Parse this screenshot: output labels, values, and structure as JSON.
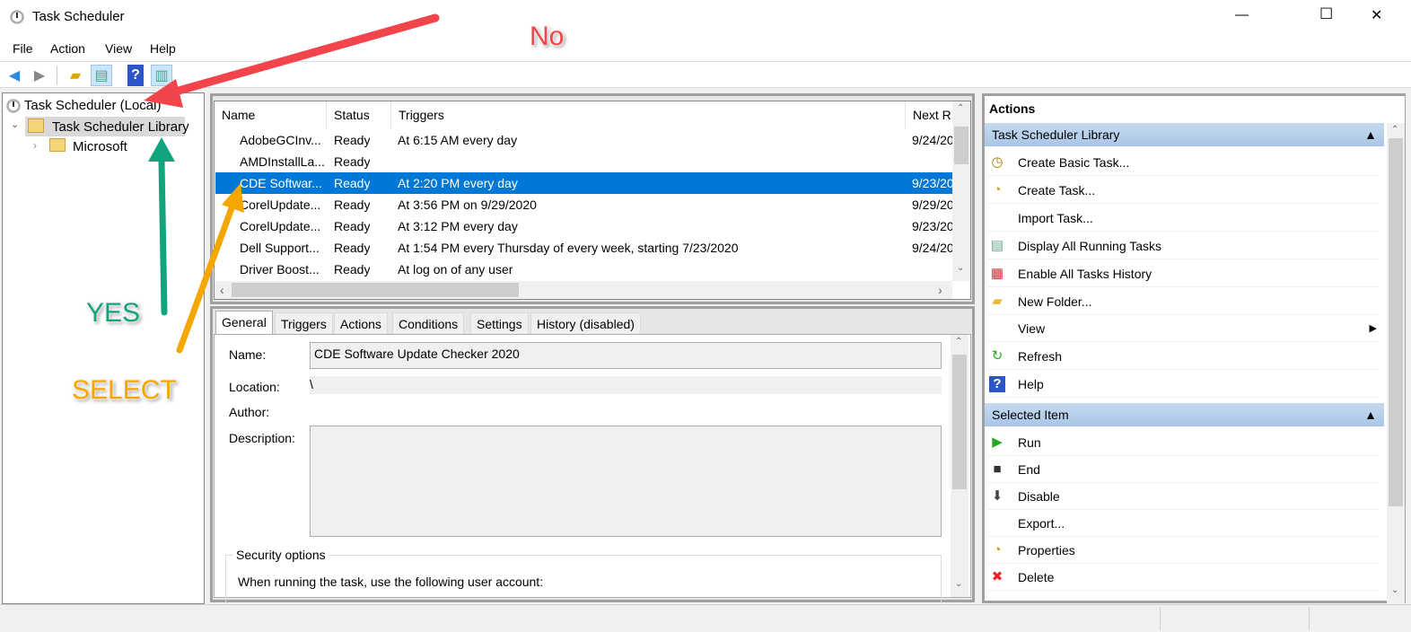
{
  "window": {
    "title": "Task Scheduler",
    "minimize": "—",
    "maximize": "☐",
    "close": "✕"
  },
  "menu": [
    "File",
    "Action",
    "View",
    "Help"
  ],
  "toolbar": {
    "back": "back-icon",
    "forward": "forward-icon",
    "up": "folder-up-icon",
    "show_hide_console_tree": "console-tree-icon",
    "help": "help-icon",
    "show_hide_action_pane": "action-pane-icon"
  },
  "tree": {
    "root": "Task Scheduler (Local)",
    "library": "Task Scheduler Library",
    "child": "Microsoft"
  },
  "task_list": {
    "columns": [
      "Name",
      "Status",
      "Triggers",
      "Next R"
    ],
    "rows": [
      {
        "name": "AdobeGCInv...",
        "status": "Ready",
        "trigger": "At 6:15 AM every day",
        "next": "9/24/20"
      },
      {
        "name": "AMDInstallLa...",
        "status": "Ready",
        "trigger": "",
        "next": ""
      },
      {
        "name": "CDE Softwar...",
        "status": "Ready",
        "trigger": "At 2:20 PM every day",
        "next": "9/23/20",
        "selected": true
      },
      {
        "name": "CorelUpdate...",
        "status": "Ready",
        "trigger": "At 3:56 PM on 9/29/2020",
        "next": "9/29/20"
      },
      {
        "name": "CorelUpdate...",
        "status": "Ready",
        "trigger": "At 3:12 PM every day",
        "next": "9/23/20"
      },
      {
        "name": "Dell Support...",
        "status": "Ready",
        "trigger": "At 1:54 PM every Thursday of every week, starting 7/23/2020",
        "next": "9/24/20"
      },
      {
        "name": "Driver Boost...",
        "status": "Ready",
        "trigger": "At log on of any user",
        "next": ""
      }
    ]
  },
  "details": {
    "tabs": [
      "General",
      "Triggers",
      "Actions",
      "Conditions",
      "Settings",
      "History (disabled)"
    ],
    "active_tab": "General",
    "name_label": "Name:",
    "name_value": "CDE Software Update Checker 2020",
    "location_label": "Location:",
    "location_value": "\\",
    "author_label": "Author:",
    "author_value": "",
    "description_label": "Description:",
    "description_value": "",
    "security_group": "Security options",
    "security_text": "When running the task, use the following user account:"
  },
  "actions_pane": {
    "title": "Actions",
    "sections": [
      {
        "title": "Task Scheduler Library",
        "items": [
          {
            "label": "Create Basic Task...",
            "icon": "create-basic-task-icon"
          },
          {
            "label": "Create Task...",
            "icon": "create-task-icon"
          },
          {
            "label": "Import Task...",
            "icon": ""
          },
          {
            "label": "Display All Running Tasks",
            "icon": "running-tasks-icon"
          },
          {
            "label": "Enable All Tasks History",
            "icon": "history-icon"
          },
          {
            "label": "New Folder...",
            "icon": "new-folder-icon"
          },
          {
            "label": "View",
            "icon": "",
            "submenu": true
          },
          {
            "label": "Refresh",
            "icon": "refresh-icon"
          },
          {
            "label": "Help",
            "icon": "help-icon"
          }
        ]
      },
      {
        "title": "Selected Item",
        "items": [
          {
            "label": "Run",
            "icon": "run-icon"
          },
          {
            "label": "End",
            "icon": "end-icon"
          },
          {
            "label": "Disable",
            "icon": "disable-icon"
          },
          {
            "label": "Export...",
            "icon": ""
          },
          {
            "label": "Properties",
            "icon": "properties-icon"
          },
          {
            "label": "Delete",
            "icon": "delete-icon"
          }
        ]
      }
    ]
  },
  "annotations": {
    "no": "No",
    "yes": "YES",
    "select": "SELECT",
    "colors": {
      "no": "#f2454b",
      "yes": "#12a37f",
      "select": "#f5a700"
    }
  },
  "colors": {
    "selection": "#0078d7",
    "section_header": "#b8d0ea"
  }
}
